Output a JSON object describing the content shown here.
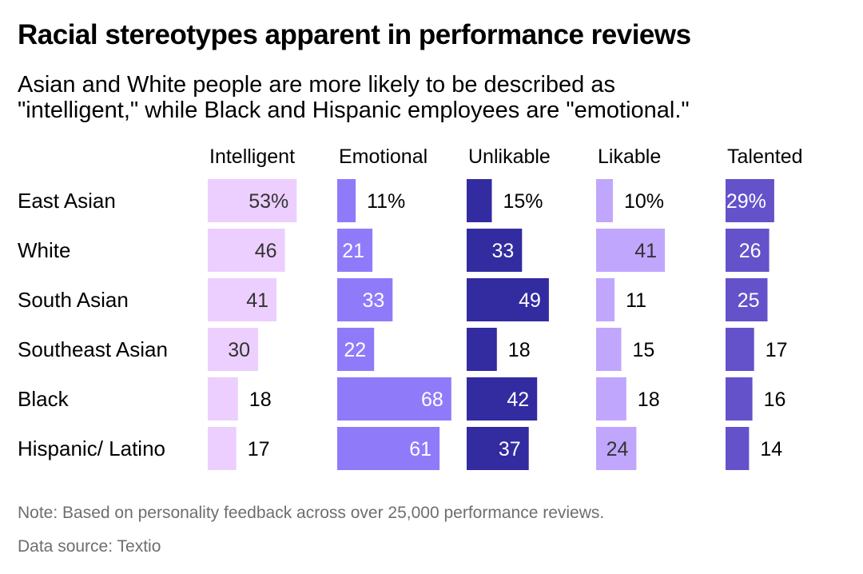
{
  "chart_data": {
    "type": "bar",
    "orientation": "horizontal",
    "layout": "small-multiples",
    "title": "Racial stereotypes apparent in performance reviews",
    "subtitle": [
      "Asian and White people are more likely to be described as",
      "\"intelligent,\" while Black and Hispanic employees are \"emotional.\""
    ],
    "xlabel": "",
    "ylabel": "",
    "unit": "%",
    "categories": [
      "East Asian",
      "White",
      "South Asian",
      "Southeast Asian",
      "Black",
      "Hispanic/ Latino"
    ],
    "series": [
      {
        "name": "Intelligent",
        "color": "#eccffe",
        "label_color": "#333333",
        "values": [
          53,
          46,
          41,
          30,
          18,
          17
        ]
      },
      {
        "name": "Emotional",
        "color": "#8f7bfa",
        "label_color": "#ffffff",
        "values": [
          11,
          21,
          33,
          22,
          68,
          61
        ]
      },
      {
        "name": "Unlikable",
        "color": "#332ba0",
        "label_color": "#ffffff",
        "values": [
          15,
          33,
          49,
          18,
          42,
          37
        ]
      },
      {
        "name": "Likable",
        "color": "#c0a7fd",
        "label_color": "#333333",
        "values": [
          10,
          41,
          11,
          15,
          18,
          24
        ]
      },
      {
        "name": "Talented",
        "color": "#6452cb",
        "label_color": "#ffffff",
        "values": [
          29,
          26,
          25,
          17,
          16,
          14
        ]
      }
    ],
    "grid": false,
    "legend": "none"
  },
  "footer": {
    "note": "Note: Based on personality feedback across over 25,000 performance reviews.",
    "source": "Data source: Textio"
  }
}
